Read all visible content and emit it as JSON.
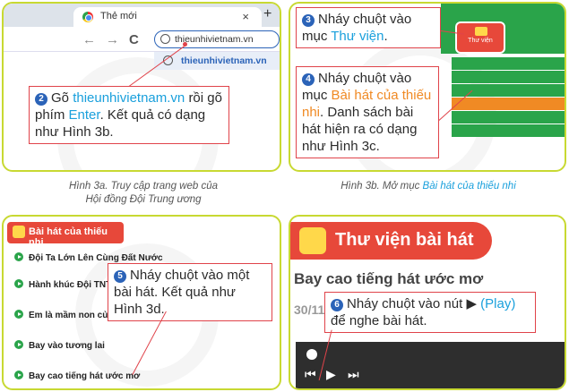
{
  "panel1": {
    "tab_title": "Thẻ mới",
    "tab_close": "×",
    "new_tab": "+",
    "nav_back": "←",
    "nav_forward": "→",
    "nav_reload": "C",
    "url": "thieunhivietnam.vn",
    "suggestion": "thieunhivietnam.vn",
    "step": "2",
    "callout": {
      "t1": "Gõ",
      "url": "thieunhivietnam.vn",
      "t2": "rồi gõ phím",
      "key": "Enter",
      "t3": ". Kết quả có dạng như Hình 3b."
    },
    "caption_line1": "Hình 3a. Truy cập trang web của",
    "caption_line2": "Hội đồng Đội Trung ương"
  },
  "panel2": {
    "library_button": "Thư viện",
    "step3": "3",
    "callout3": {
      "t1": "Nháy chuột vào mục",
      "target": "Thư viện",
      "t2": "."
    },
    "step4": "4",
    "callout4": {
      "t1": "Nháy chuột vào mục",
      "target": "Bài hát của thiếu nhi",
      "t2": ". Danh sách bài hát hiện ra có dạng như Hình 3c."
    },
    "caption_prefix": "Hình 3b. Mở mục",
    "caption_target": "Bài hát của thiếu nhi"
  },
  "panel3": {
    "header": "Bài hát của thiếu nhi",
    "songs": [
      "Đội Ta Lớn Lên Cùng Đất Nước",
      "Hành khúc Đội TNTP",
      "Em là mầm non của Đả",
      "Bay vào tương lai",
      "Bay cao tiếng hát ước mơ"
    ],
    "step": "5",
    "callout": "Nháy chuột vào một bài hát. Kết quả như Hình 3d."
  },
  "panel4": {
    "header": "Thư viện bài hát",
    "song_title": "Bay cao tiếng hát ước mơ",
    "date_fragment": "30/11",
    "step": "6",
    "callout": {
      "t1": "Nháy chuột vào nút",
      "play_symbol": "▶",
      "play_label": "(Play)",
      "t2": "để nghe bài hát."
    },
    "controls": {
      "prev": "⏮",
      "play": "▶",
      "next": "⏭"
    }
  },
  "colors": {
    "border": "#c8d932",
    "callout_border": "#e0434a",
    "link_blue": "#1aa0dc",
    "highlight_orange": "#f08a24",
    "step_badge": "#2b63b8"
  }
}
